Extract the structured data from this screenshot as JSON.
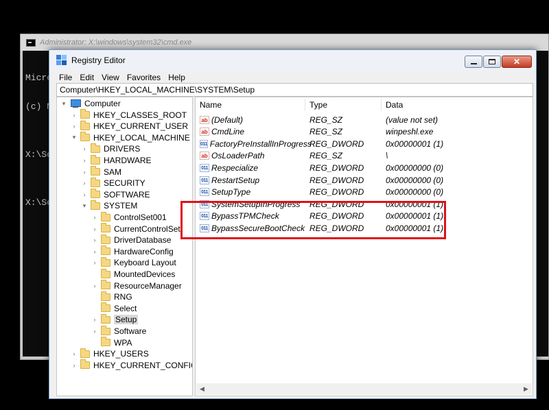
{
  "cmd": {
    "title": "Administrator: X:\\windows\\system32\\cmd.exe",
    "console_lines": [
      "Micro",
      "(c) M",
      "",
      "X:\\So",
      "",
      "X:\\So"
    ]
  },
  "regedit": {
    "title": "Registry Editor",
    "menu": [
      "File",
      "Edit",
      "View",
      "Favorites",
      "Help"
    ],
    "address": "Computer\\HKEY_LOCAL_MACHINE\\SYSTEM\\Setup",
    "tree": [
      {
        "label": "Computer",
        "exp": "▾",
        "icon": "computer-icon"
      },
      {
        "label": "HKEY_CLASSES_ROOT",
        "exp": "›",
        "icon": "folder-icon"
      },
      {
        "label": "HKEY_CURRENT_USER",
        "exp": "›",
        "icon": "folder-icon"
      },
      {
        "label": "HKEY_LOCAL_MACHINE",
        "exp": "▾",
        "icon": "folder-icon"
      },
      {
        "label": "DRIVERS",
        "exp": "›",
        "icon": "folder-icon"
      },
      {
        "label": "HARDWARE",
        "exp": "›",
        "icon": "folder-icon"
      },
      {
        "label": "SAM",
        "exp": "›",
        "icon": "folder-icon"
      },
      {
        "label": "SECURITY",
        "exp": "›",
        "icon": "folder-icon"
      },
      {
        "label": "SOFTWARE",
        "exp": "›",
        "icon": "folder-icon"
      },
      {
        "label": "SYSTEM",
        "exp": "▾",
        "icon": "folder-icon"
      },
      {
        "label": "ControlSet001",
        "exp": "›",
        "icon": "folder-icon"
      },
      {
        "label": "CurrentControlSet",
        "exp": "›",
        "icon": "folder-icon"
      },
      {
        "label": "DriverDatabase",
        "exp": "›",
        "icon": "folder-icon"
      },
      {
        "label": "HardwareConfig",
        "exp": "›",
        "icon": "folder-icon"
      },
      {
        "label": "Keyboard Layout",
        "exp": "›",
        "icon": "folder-icon"
      },
      {
        "label": "MountedDevices",
        "exp": "",
        "icon": "folder-icon"
      },
      {
        "label": "ResourceManager",
        "exp": "›",
        "icon": "folder-icon"
      },
      {
        "label": "RNG",
        "exp": "",
        "icon": "folder-icon"
      },
      {
        "label": "Select",
        "exp": "",
        "icon": "folder-icon"
      },
      {
        "label": "Setup",
        "exp": "›",
        "icon": "folder-icon",
        "selected": true
      },
      {
        "label": "Software",
        "exp": "›",
        "icon": "folder-icon"
      },
      {
        "label": "WPA",
        "exp": "",
        "icon": "folder-icon"
      },
      {
        "label": "HKEY_USERS",
        "exp": "›",
        "icon": "folder-icon"
      },
      {
        "label": "HKEY_CURRENT_CONFIG",
        "exp": "›",
        "icon": "folder-icon"
      }
    ],
    "columns": {
      "name": "Name",
      "type": "Type",
      "data": "Data"
    },
    "values": [
      {
        "name": "(Default)",
        "type": "REG_SZ",
        "data": "(value not set)",
        "icon": "ab"
      },
      {
        "name": "CmdLine",
        "type": "REG_SZ",
        "data": "winpeshl.exe",
        "icon": "ab"
      },
      {
        "name": "FactoryPreInstallInProgress",
        "type": "REG_DWORD",
        "data": "0x00000001 (1)",
        "icon": "011"
      },
      {
        "name": "OsLoaderPath",
        "type": "REG_SZ",
        "data": "\\",
        "icon": "ab"
      },
      {
        "name": "Respecialize",
        "type": "REG_DWORD",
        "data": "0x00000000 (0)",
        "icon": "011"
      },
      {
        "name": "RestartSetup",
        "type": "REG_DWORD",
        "data": "0x00000000 (0)",
        "icon": "011"
      },
      {
        "name": "SetupType",
        "type": "REG_DWORD",
        "data": "0x00000000 (0)",
        "icon": "011"
      },
      {
        "name": "SystemSetupInProgress",
        "type": "REG_DWORD",
        "data": "0x00000001 (1)",
        "icon": "011"
      },
      {
        "name": "BypassTPMCheck",
        "type": "REG_DWORD",
        "data": "0x00000001 (1)",
        "icon": "011"
      },
      {
        "name": "BypassSecureBootCheck",
        "type": "REG_DWORD",
        "data": "0x00000001 (1)",
        "icon": "011"
      }
    ],
    "highlight_color": "#e0101a"
  }
}
